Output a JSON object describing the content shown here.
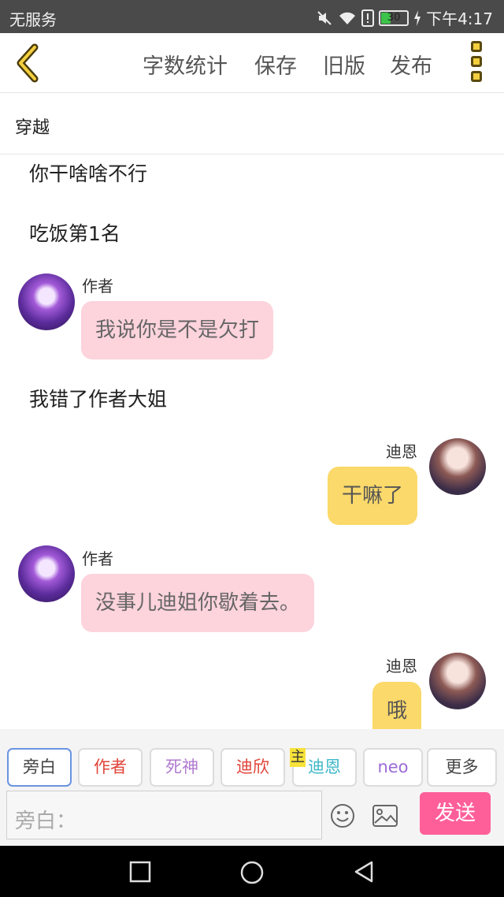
{
  "status_bar": {
    "carrier": "无服务",
    "battery": "30",
    "time": "下午4:17"
  },
  "toolbar": {
    "word_count": "字数统计",
    "save": "保存",
    "old_version": "旧版",
    "publish": "发布"
  },
  "chapter": {
    "title": "穿越"
  },
  "messages": {
    "narr1": "你干啥啥不行",
    "narr2": "吃饭第1名",
    "m1_name": "作者",
    "m1_text": "我说你是不是欠打",
    "narr3": "我错了作者大姐",
    "m2_name": "迪恩",
    "m2_text": "干嘛了",
    "m3_name": "作者",
    "m3_text": "没事儿迪姐你歇着去。",
    "m4_name": "迪恩",
    "m4_text": "哦"
  },
  "roles": {
    "narrator": "旁白",
    "author": "作者",
    "death": "死神",
    "dixin": "迪欣",
    "dien": "迪恩",
    "neo": "neo",
    "more": "更多",
    "main_tag": "主"
  },
  "role_colors": {
    "author": "#e0443a",
    "death": "#b07ad0",
    "dixin": "#e0443a",
    "dien": "#3fb8c8",
    "neo": "#9b6bd6"
  },
  "composer": {
    "placeholder": "旁白：",
    "send": "发送"
  },
  "icons": [
    "back-chevron-icon",
    "kebab-menu-icon",
    "mute-icon",
    "wifi-icon",
    "alert-icon",
    "battery-icon",
    "charging-icon",
    "emoji-icon",
    "image-icon",
    "nav-square-icon",
    "nav-circle-icon",
    "nav-back-icon"
  ]
}
